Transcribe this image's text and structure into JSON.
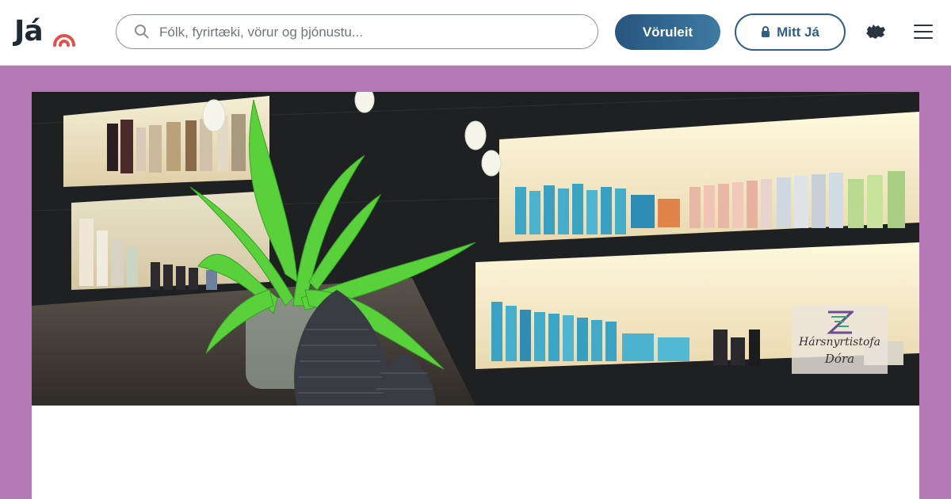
{
  "header": {
    "logo_text": "Já",
    "search": {
      "placeholder": "Fólk, fyrirtæki, vörur og þjónustu..."
    },
    "voruleit_label": "Vöruleit",
    "mittja_label": "Mitt Já"
  },
  "banner": {
    "badge_line1": "Hársnyrtistofa",
    "badge_line2": "Dóra"
  },
  "colors": {
    "page_background": "#b479b4",
    "header_background": "#ffffff",
    "primary_button": "#2f6690",
    "logo_accent": "#e2514a"
  },
  "icons": [
    "search-icon",
    "lock-icon",
    "iceland-icon",
    "menu-icon",
    "logo-signal-icon"
  ]
}
